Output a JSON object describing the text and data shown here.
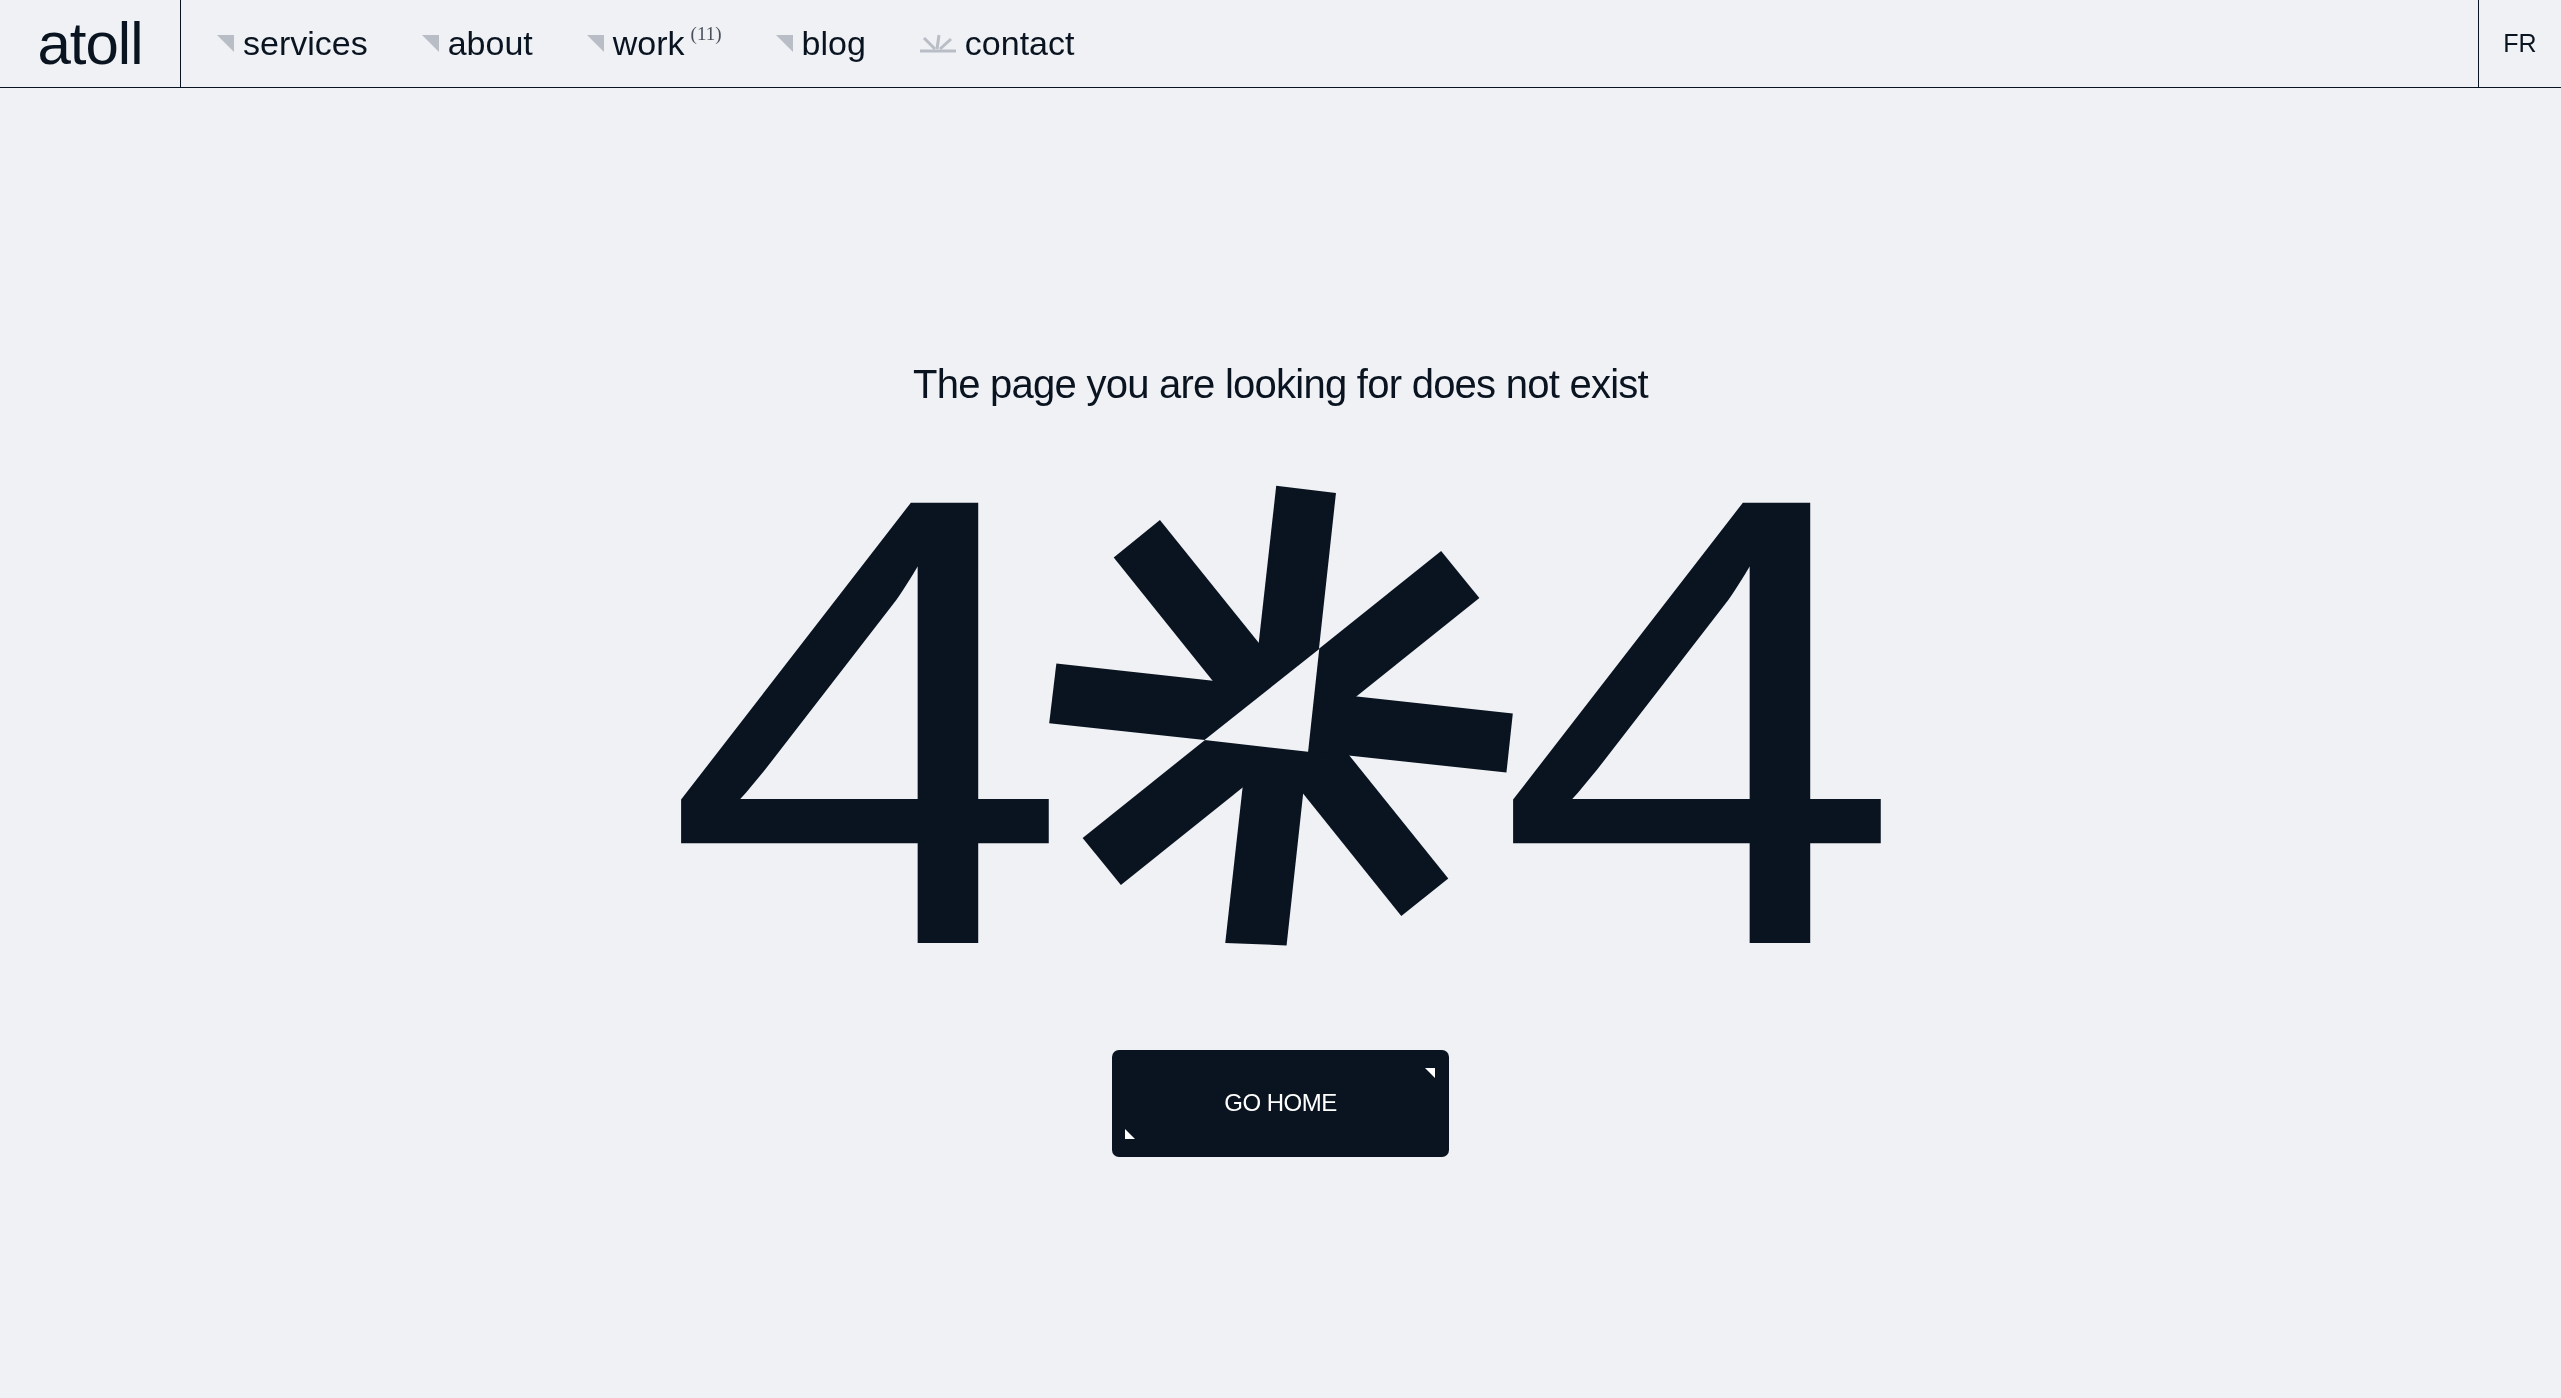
{
  "header": {
    "logo": "atoll",
    "nav": [
      {
        "label": "services",
        "kind": "link"
      },
      {
        "label": "about",
        "kind": "link"
      },
      {
        "label": "work",
        "kind": "link",
        "count": "(11)"
      },
      {
        "label": "blog",
        "kind": "link"
      },
      {
        "label": "contact",
        "kind": "contact"
      }
    ],
    "language": "FR"
  },
  "main": {
    "message": "The page you are looking for does not exist",
    "error_code": {
      "first_digit": "4",
      "last_digit": "4"
    },
    "button": {
      "label": "GO HOME"
    }
  }
}
